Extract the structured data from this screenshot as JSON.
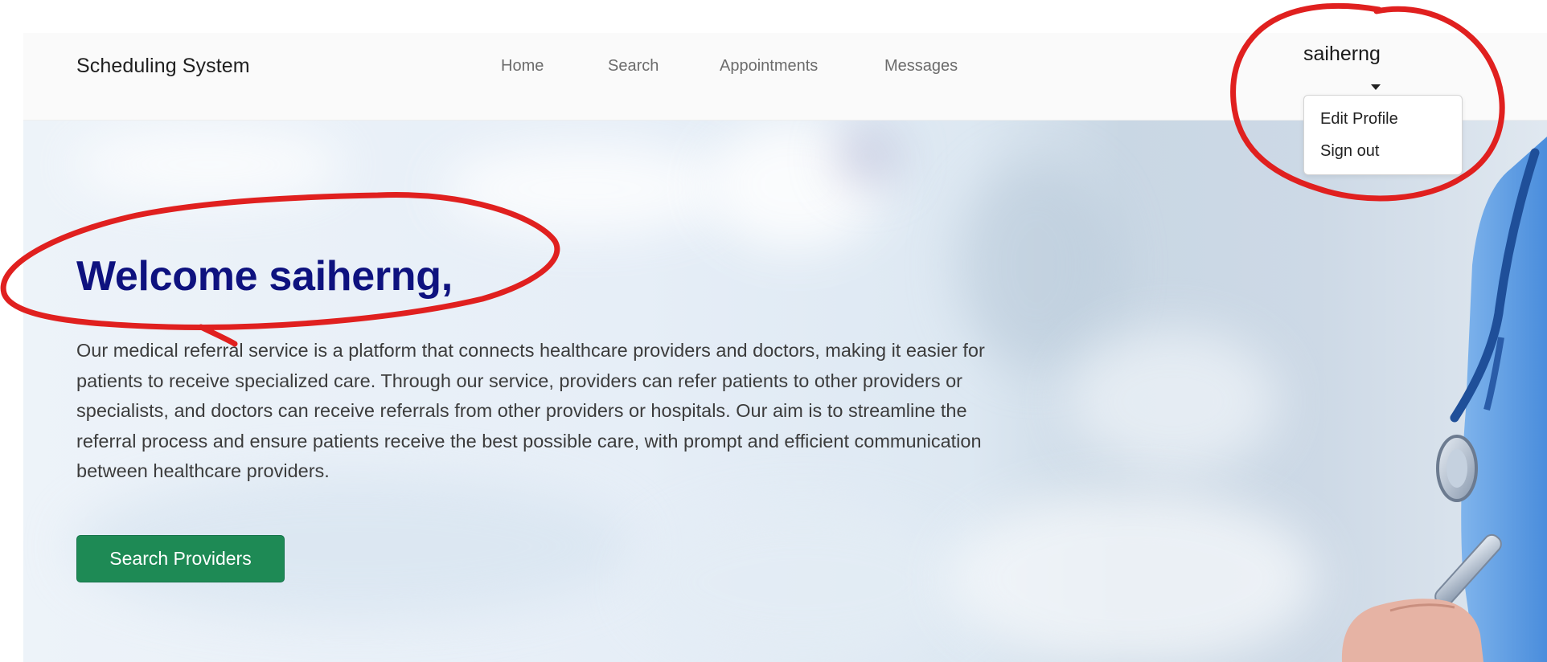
{
  "navbar": {
    "brand": "Scheduling System",
    "links": [
      "Home",
      "Search",
      "Appointments",
      "Messages"
    ]
  },
  "user_menu": {
    "username": "saiherng",
    "items": [
      "Edit Profile",
      "Sign out"
    ]
  },
  "hero": {
    "title": "Welcome saiherng,",
    "description": "Our medical referral service is a platform that connects healthcare providers and doctors, making it easier for patients to receive specialized care. Through our service, providers can refer patients to other providers or specialists, and doctors can receive referrals from other providers or hospitals. Our aim is to streamline the referral process and ensure patients receive the best possible care, with prompt and efficient communication between healthcare providers.",
    "cta_label": "Search Providers"
  },
  "colors": {
    "title": "#0e127f",
    "cta": "#1e8a55",
    "annotation": "#e0201f"
  },
  "icons": [
    "caret-down-icon",
    "stethoscope-illustration"
  ]
}
